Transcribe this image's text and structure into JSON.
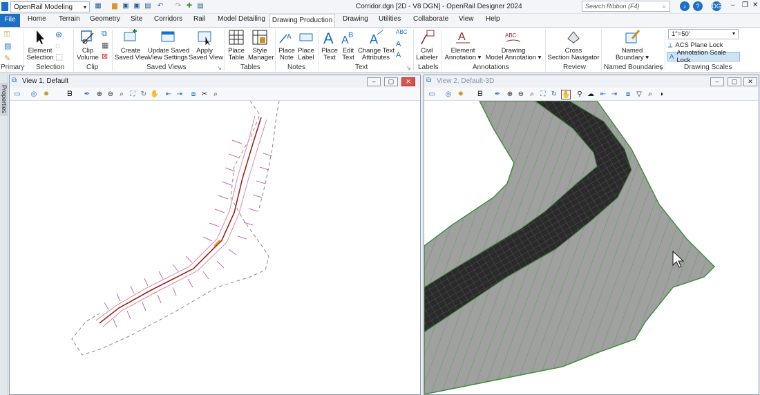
{
  "workspace": {
    "value": "OpenRail Modeling"
  },
  "window": {
    "title": "Corridor.dgn [2D - V8 DGN] - OpenRail Designer 2024"
  },
  "search": {
    "placeholder": "Search Ribbon (F4)"
  },
  "user_badge": "DG",
  "tabs": [
    {
      "label": "File"
    },
    {
      "label": "Home"
    },
    {
      "label": "Terrain"
    },
    {
      "label": "Geometry"
    },
    {
      "label": "Site"
    },
    {
      "label": "Corridors"
    },
    {
      "label": "Rail"
    },
    {
      "label": "Model Detailing"
    },
    {
      "label": "Drawing Production"
    },
    {
      "label": "Drawing"
    },
    {
      "label": "Utilities"
    },
    {
      "label": "Collaborate"
    },
    {
      "label": "View"
    },
    {
      "label": "Help"
    }
  ],
  "ribbon": {
    "element_selection": {
      "l1": "Element",
      "l2": "Selection"
    },
    "clip_volume": {
      "l1": "Clip",
      "l2": "Volume"
    },
    "create_saved_view": {
      "l1": "Create",
      "l2": "Saved View"
    },
    "update_saved_view": {
      "l1": "Update Saved",
      "l2": "View Settings"
    },
    "apply_saved_view": {
      "l1": "Apply",
      "l2": "Saved View"
    },
    "place_table": {
      "l1": "Place",
      "l2": "Table"
    },
    "style_manager": {
      "l1": "Style",
      "l2": "Manager"
    },
    "place_note": {
      "l1": "Place",
      "l2": "Note"
    },
    "place_label": {
      "l1": "Place",
      "l2": "Label"
    },
    "place_text": {
      "l1": "Place",
      "l2": "Text"
    },
    "edit_text": {
      "l1": "Edit",
      "l2": "Text"
    },
    "change_text": {
      "l1": "Change Text",
      "l2": "Attributes"
    },
    "civil_labeler": {
      "l1": "Civil",
      "l2": "Labeler"
    },
    "element_annotation": {
      "l1": "Element",
      "l2": "Annotation"
    },
    "drawing_model_annotation": {
      "l1": "Drawing",
      "l2": "Model Annotation"
    },
    "cross_section": {
      "l1": "Cross",
      "l2": "Section Navigator"
    },
    "named_boundary": {
      "l1": "Named",
      "l2": "Boundary"
    },
    "scale_value": "1\"=50'",
    "acs_plane_lock": "ACS Plane Lock",
    "annotation_scale_lock": "Annotation Scale Lock",
    "groups": {
      "primary": "Primary",
      "selection": "Selection",
      "clip": "Clip",
      "saved_views": "Saved Views",
      "tables": "Tables",
      "notes": "Notes",
      "text": "Text",
      "labels": "Labels",
      "annotations": "Annotations",
      "review": "Review",
      "named_boundaries": "Named Boundaries",
      "drawing_scales": "Drawing Scales"
    },
    "icon_text": {
      "abc": "ABC",
      "a": "A"
    }
  },
  "properties_label": "Properties",
  "views": [
    {
      "title": "View 1, Default"
    },
    {
      "title": "View 2, Default-3D"
    }
  ],
  "colors": {
    "accent": "#1c6fc4",
    "alignment": "#a02020",
    "corridor_green": "#3f8f3a"
  }
}
